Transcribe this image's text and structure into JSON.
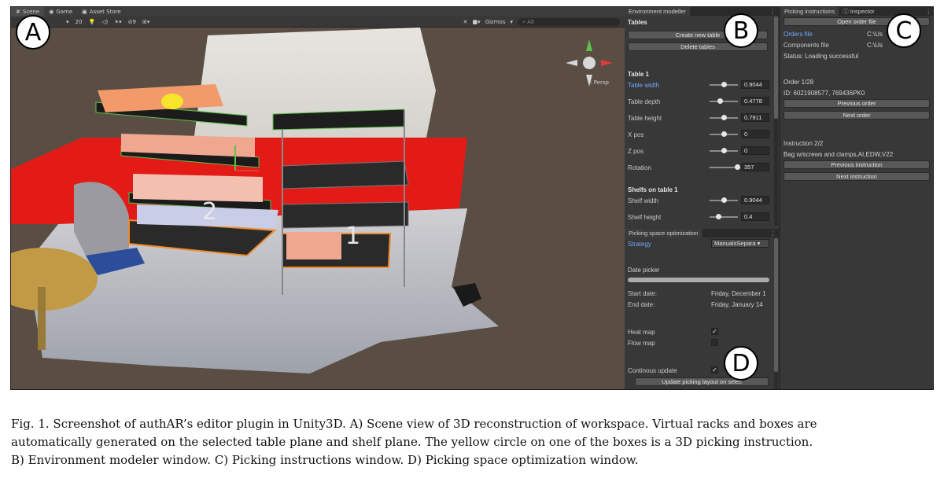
{
  "scene": {
    "tabs": [
      "Scene",
      "Game",
      "Asset Store"
    ],
    "toolbar": {
      "value_20": "20",
      "visible_count": "9",
      "gizmos": "Gizmos",
      "search_placeholder": "All"
    },
    "persp_label": "< Persp",
    "shelf_labels": [
      "2",
      "1"
    ]
  },
  "env": {
    "tabs": [
      "Environment modeller"
    ],
    "section_tables": "Tables",
    "create_btn": "Create new table",
    "delete_btn": "Delete tables",
    "table_heading": "Table 1",
    "fields": [
      {
        "label": "Table width",
        "value": "0.9044",
        "highlight": true,
        "knob": 0.5
      },
      {
        "label": "Table depth",
        "value": "0.4778",
        "highlight": false,
        "knob": 0.35
      },
      {
        "label": "Table height",
        "value": "0.7911",
        "highlight": false,
        "knob": 0.5
      },
      {
        "label": "X pos",
        "value": "0",
        "highlight": false,
        "knob": 0.5
      },
      {
        "label": "Z pos",
        "value": "0",
        "highlight": false,
        "knob": 0.5
      },
      {
        "label": "Rotation",
        "value": "357",
        "highlight": false,
        "knob": 0.98
      }
    ],
    "shelf_heading": "Shelfs on table 1",
    "shelf_fields": [
      {
        "label": "Shelf width",
        "value": "0.9044",
        "knob": 0.5
      },
      {
        "label": "Shelf height",
        "value": "0.4",
        "knob": 0.3
      }
    ]
  },
  "picking": {
    "tabs": [
      "Picking instructions",
      "Inspector"
    ],
    "open_btn": "Open order file",
    "orders_label": "Orders file",
    "orders_value": "C:\\Us",
    "components_label": "Components file",
    "components_value": "C:\\Us",
    "status": "Status: Loading successful",
    "order_heading": "Order 1/28",
    "order_id": "ID: 6021908577, 769436PK0",
    "prev_order": "Previous order",
    "next_order": "Next order",
    "instr_heading": "Instruction 2/2",
    "instr_text": "Bag w/screws and clamps,AI,EDW,V22",
    "prev_instr": "Previous instruction",
    "next_instr": "Next instruction"
  },
  "optim": {
    "tab": "Picking space optimization",
    "strategy_label": "Strategy",
    "strategy_value": "ManualsSepara",
    "date_picker": "Date picker",
    "start_label": "Start date:",
    "start_value": "Friday, December 1",
    "end_label": "End date:",
    "end_value": "Friday, January 14",
    "heatmap_label": "Heat map",
    "flowmap_label": "Flow map",
    "continuous_label": "Continous update",
    "update_btn": "Update picking layout on selec",
    "heatmap_checked": "✓",
    "continuous_checked": "✓"
  },
  "labels": {
    "a": "A",
    "b": "B",
    "c": "C",
    "d": "D"
  },
  "caption": {
    "line1": "Fig. 1.  Screenshot of authAR’s editor plugin in Unity3D. A) Scene view of 3D reconstruction of workspace. Virtual racks and boxes are",
    "line2": "automatically generated on the selected table plane and shelf plane. The yellow circle on one of the boxes is a 3D picking instruction.",
    "line3": "B) Environment modeler window. C) Picking instructions window. D) Picking space optimization window."
  }
}
